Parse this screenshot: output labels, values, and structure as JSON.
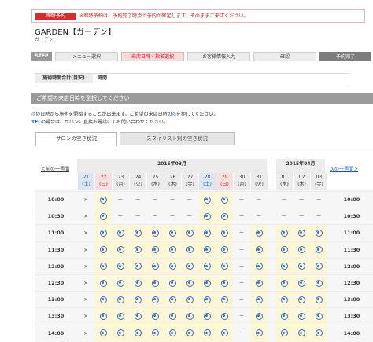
{
  "notice": {
    "button": "即時予約",
    "text": "※即時予約は、予約完了時点で予約が確定します。そのままご来店ください。"
  },
  "shop": {
    "name": "GARDEN【ガーデン】",
    "kana": "ガーデン"
  },
  "steps": {
    "label": "STEP",
    "items": [
      "メニュー選択",
      "来店日時・指名選択",
      "お客様情報入力",
      "確認",
      "予約完了"
    ],
    "active_index": 1
  },
  "total": {
    "label": "施術時間合計(目安)",
    "value": "時間"
  },
  "section": {
    "title": "ご希望の来店日時を選択してください"
  },
  "info": {
    "line1_a": "◎",
    "line1_b": "の日時から施術を開始することが出来ます。ご希望の来店日時の",
    "line1_c": "◎",
    "line1_d": "を押してください。",
    "line2_a": "TEL",
    "line2_b": "の場合は、サロンに直接お電話にてお問い合わせください。"
  },
  "tabs": [
    {
      "label": "サロンの空き状況"
    },
    {
      "label": "スタイリスト別の空き状況"
    }
  ],
  "nav": {
    "prev": "＜前の一週間",
    "next": "次の一週間＞"
  },
  "months": [
    {
      "label": "2015年03月"
    },
    {
      "label": "2015年04月"
    }
  ],
  "days": [
    {
      "d": "21",
      "w": "(土)",
      "t": "sat"
    },
    {
      "d": "22",
      "w": "(日)",
      "t": "sun"
    },
    {
      "d": "23",
      "w": "(月)",
      "t": ""
    },
    {
      "d": "24",
      "w": "(火)",
      "t": ""
    },
    {
      "d": "25",
      "w": "(水)",
      "t": ""
    },
    {
      "d": "26",
      "w": "(木)",
      "t": ""
    },
    {
      "d": "27",
      "w": "(金)",
      "t": ""
    },
    {
      "d": "28",
      "w": "(土)",
      "t": "sat"
    },
    {
      "d": "29",
      "w": "(日)",
      "t": "sun"
    },
    {
      "d": "30",
      "w": "(月)",
      "t": ""
    },
    {
      "d": "31",
      "w": "(火)",
      "t": ""
    },
    {
      "d": "01",
      "w": "(水)",
      "t": ""
    },
    {
      "d": "02",
      "w": "(木)",
      "t": ""
    },
    {
      "d": "03",
      "w": "(金)",
      "t": ""
    }
  ],
  "slots": [
    {
      "time": "10:00",
      "cells": [
        "×",
        "◎",
        "－",
        "－",
        "－",
        "－",
        "－",
        "◎",
        "◎",
        "－",
        "－",
        "－",
        "－",
        "－"
      ]
    },
    {
      "time": "10:30",
      "cells": [
        "×",
        "◎",
        "－",
        "－",
        "－",
        "－",
        "－",
        "◎",
        "◎",
        "－",
        "－",
        "－",
        "－",
        "－"
      ]
    },
    {
      "time": "11:00",
      "cells": [
        "×",
        "◎",
        "◎",
        "◎",
        "◎",
        "◎",
        "◎",
        "◎",
        "◎",
        "－",
        "◎",
        "◎",
        "◎",
        "◎"
      ]
    },
    {
      "time": "11:30",
      "cells": [
        "×",
        "◎",
        "◎",
        "◎",
        "◎",
        "◎",
        "◎",
        "◎",
        "◎",
        "－",
        "◎",
        "◎",
        "◎",
        "◎"
      ]
    },
    {
      "time": "12:00",
      "cells": [
        "×",
        "◎",
        "◎",
        "◎",
        "◎",
        "◎",
        "◎",
        "◎",
        "◎",
        "－",
        "◎",
        "◎",
        "◎",
        "◎"
      ]
    },
    {
      "time": "12:30",
      "cells": [
        "×",
        "◎",
        "◎",
        "◎",
        "◎",
        "◎",
        "◎",
        "◎",
        "◎",
        "－",
        "◎",
        "◎",
        "◎",
        "◎"
      ]
    },
    {
      "time": "13:00",
      "cells": [
        "×",
        "◎",
        "◎",
        "◎",
        "◎",
        "◎",
        "◎",
        "◎",
        "◎",
        "－",
        "◎",
        "◎",
        "◎",
        "◎"
      ]
    },
    {
      "time": "13:30",
      "cells": [
        "×",
        "◎",
        "◎",
        "◎",
        "◎",
        "◎",
        "◎",
        "◎",
        "◎",
        "－",
        "◎",
        "◎",
        "◎",
        "◎"
      ]
    },
    {
      "time": "14:00",
      "cells": [
        "×",
        "◎",
        "◎",
        "◎",
        "◎",
        "◎",
        "◎",
        "◎",
        "◎",
        "－",
        "◎",
        "◎",
        "◎",
        "◎"
      ]
    }
  ],
  "colors": {
    "accent": "#d22e2e",
    "blue": "#1b56b8",
    "available_bg": "#fbf7d8"
  }
}
